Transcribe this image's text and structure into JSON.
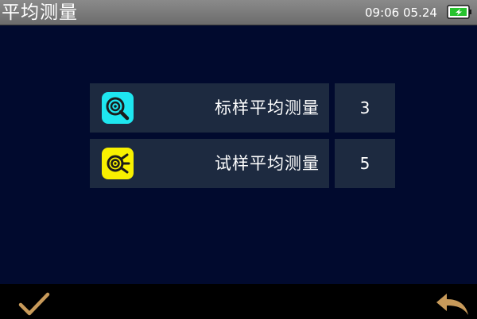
{
  "header": {
    "title": "平均测量",
    "clock": "09:06 05.24",
    "battery_icon": "battery-charging-icon"
  },
  "colors": {
    "accent_cyan": "#1ee6f0",
    "accent_yellow": "#f8f000",
    "cell_bg": "#1d2a40",
    "action_icon": "#c89a5a"
  },
  "rows": [
    {
      "icon": "standard-sample-icon",
      "label": "标样平均测量",
      "value": "3"
    },
    {
      "icon": "test-sample-icon",
      "label": "试样平均测量",
      "value": "5"
    }
  ],
  "footer": {
    "confirm_icon": "checkmark-icon",
    "back_icon": "back-arrow-icon"
  }
}
